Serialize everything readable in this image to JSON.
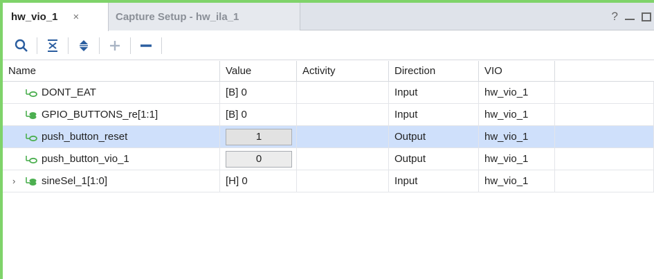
{
  "tabs": {
    "active_label": "hw_vio_1",
    "active_close": "×",
    "inactive_label": "Capture Setup - hw_ila_1"
  },
  "window_controls": {
    "help": "?"
  },
  "toolbar": {
    "icons": [
      "search-icon",
      "collapse-all-icon",
      "expand-all-icon",
      "add-icon",
      "remove-icon"
    ]
  },
  "table": {
    "columns": [
      "Name",
      "Value",
      "Activity",
      "Direction",
      "VIO"
    ],
    "rows": [
      {
        "name": "DONT_EAT",
        "value": "[B] 0",
        "activity": "",
        "direction": "Input",
        "vio": "hw_vio_1",
        "expandable": false,
        "editable": false,
        "selected": false
      },
      {
        "name": "GPIO_BUTTONS_re[1:1]",
        "value": "[B] 0",
        "activity": "",
        "direction": "Input",
        "vio": "hw_vio_1",
        "expandable": false,
        "editable": false,
        "selected": false
      },
      {
        "name": "push_button_reset",
        "value": "1",
        "activity": "",
        "direction": "Output",
        "vio": "hw_vio_1",
        "expandable": false,
        "editable": true,
        "selected": true
      },
      {
        "name": "push_button_vio_1",
        "value": "0",
        "activity": "",
        "direction": "Output",
        "vio": "hw_vio_1",
        "expandable": false,
        "editable": true,
        "selected": false
      },
      {
        "name": "sineSel_1[1:0]",
        "value": "[H] 0",
        "activity": "",
        "direction": "Input",
        "vio": "hw_vio_1",
        "expandable": true,
        "editable": false,
        "selected": false
      }
    ]
  },
  "colors": {
    "accent_border": "#7fd36a",
    "selection": "#cfe0fb",
    "signal_icon": "#4caf50"
  }
}
